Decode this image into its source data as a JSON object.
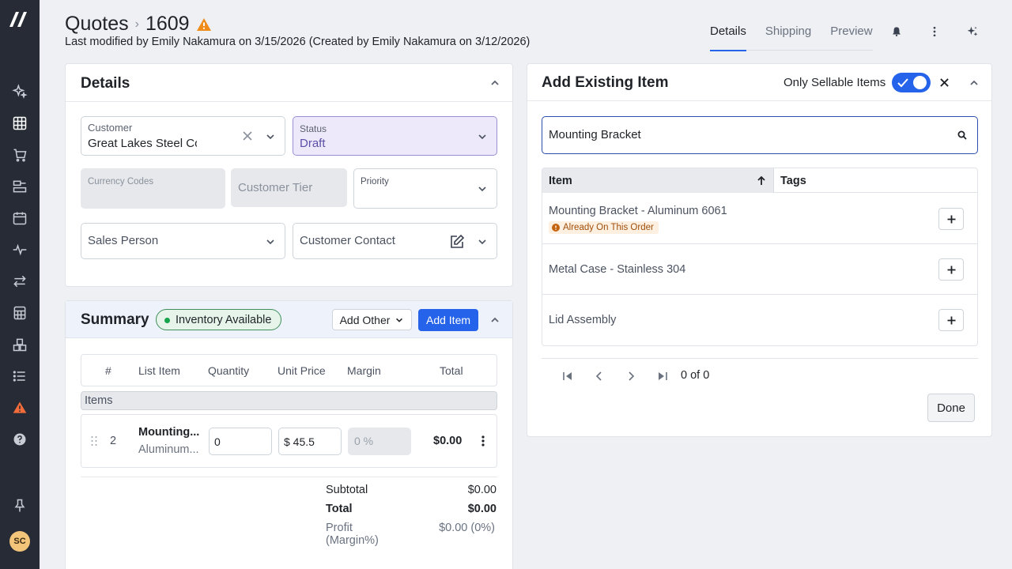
{
  "sidebar": {
    "avatar_initials": "SC",
    "icons": [
      "sparkles-icon",
      "dashboard-icon",
      "cart-icon",
      "machine-icon",
      "calendar-icon",
      "activity-icon",
      "transfer-icon",
      "calculator-icon",
      "inventory-icon",
      "list-icon",
      "alert-icon",
      "help-icon",
      "pin-icon"
    ]
  },
  "header": {
    "breadcrumb_root": "Quotes",
    "breadcrumb_sep": "›",
    "quote_number": "1609",
    "modified_line": "Last modified by Emily Nakamura on 3/15/2026 (Created by Emily Nakamura on 3/12/2026)",
    "tabs": [
      {
        "label": "Details",
        "active": true
      },
      {
        "label": "Shipping",
        "active": false
      },
      {
        "label": "Preview",
        "active": false
      }
    ]
  },
  "details": {
    "title": "Details",
    "customer_label": "Customer",
    "customer_value": "Great Lakes Steel Co",
    "status_label": "Status",
    "status_value": "Draft",
    "currency_label": "Currency Codes",
    "customer_tier_placeholder": "Customer Tier",
    "priority_label": "Priority",
    "sales_person_placeholder": "Sales Person",
    "customer_contact_placeholder": "Customer Contact"
  },
  "summary": {
    "title": "Summary",
    "badge": "Inventory Available",
    "add_other_label": "Add Other",
    "add_item_label": "Add Item",
    "columns": [
      "#",
      "List Item",
      "Quantity",
      "Unit Price",
      "Margin",
      "Total"
    ],
    "group_label": "Items",
    "row": {
      "number": "2",
      "name": "Mounting...",
      "sub": "Aluminum...",
      "quantity": "0",
      "unit_price": "$ 45.5",
      "margin": "0 %",
      "total": "$0.00"
    },
    "subtotal_label": "Subtotal",
    "subtotal_value": "$0.00",
    "total_label": "Total",
    "total_value": "$0.00",
    "profit_label_1": "Profit",
    "profit_label_2": "(Margin%)",
    "profit_value": "$0.00 (0%)"
  },
  "add_existing": {
    "title": "Add Existing Item",
    "toggle_label": "Only Sellable Items",
    "toggle_on": true,
    "search_value": "Mounting Bracket",
    "col_item": "Item",
    "col_tags": "Tags",
    "items": [
      {
        "name": "Mounting Bracket - Aluminum 6061",
        "warning": "Already On This Order"
      },
      {
        "name": "Metal Case - Stainless 304",
        "warning": ""
      },
      {
        "name": "Lid Assembly",
        "warning": ""
      }
    ],
    "pagination": "0 of 0",
    "done_label": "Done"
  },
  "colors": {
    "accent": "#2563eb",
    "sidebar_bg": "#262b35",
    "warning": "#f08c1a",
    "success": "#16a34a"
  }
}
